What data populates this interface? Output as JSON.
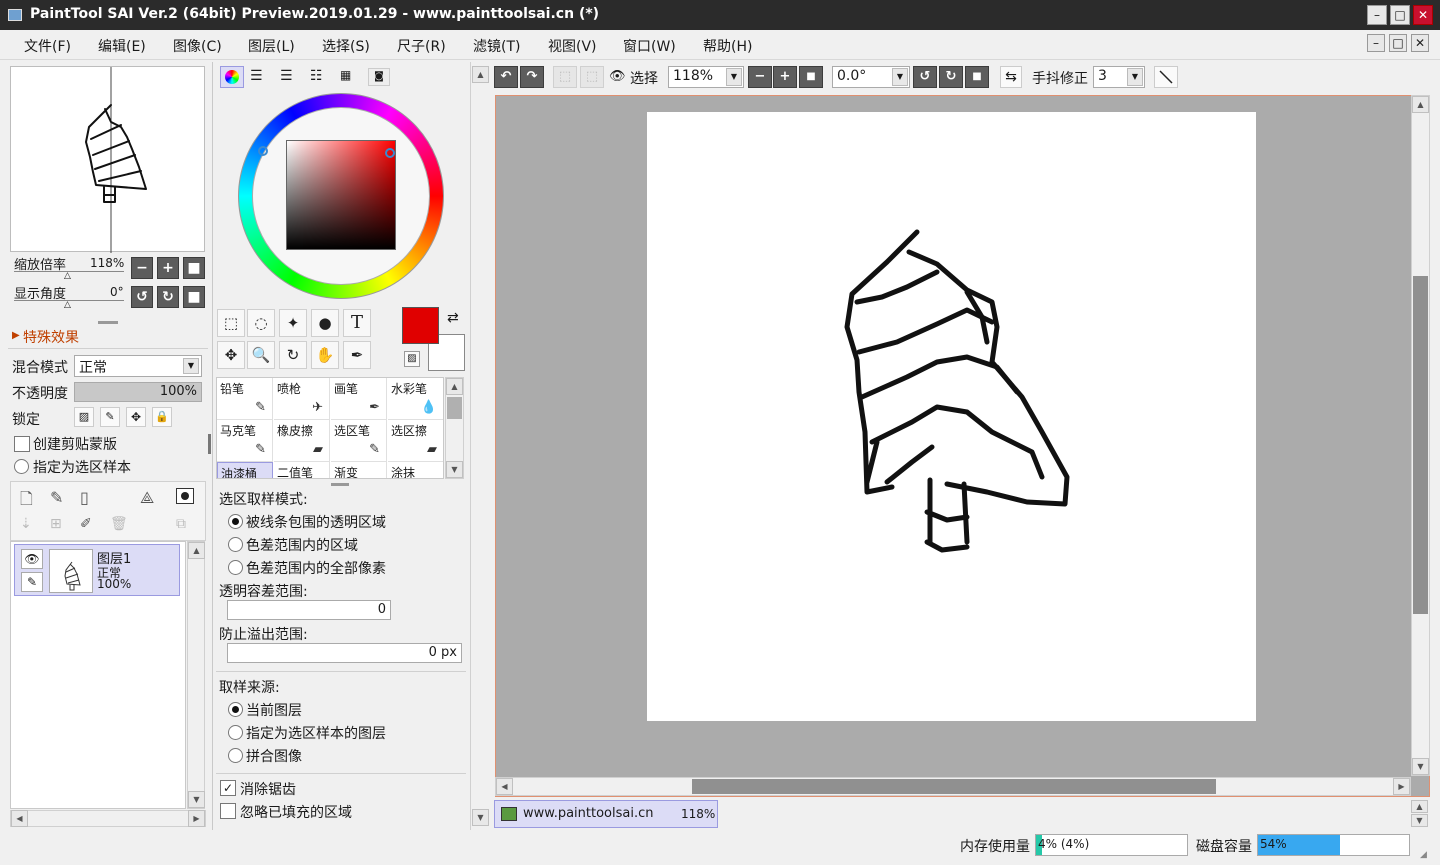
{
  "window": {
    "title": "PaintTool SAI Ver.2 (64bit) Preview.2019.01.29 - www.painttoolsai.cn (*)",
    "minimize": "–",
    "maximize": "□",
    "close": "✕"
  },
  "menu": [
    "文件(F)",
    "编辑(E)",
    "图像(C)",
    "图层(L)",
    "选择(S)",
    "尺子(R)",
    "滤镜(T)",
    "视图(V)",
    "窗口(W)",
    "帮助(H)"
  ],
  "navigator": {
    "zoom_label": "缩放倍率",
    "zoom_value": "118%",
    "angle_label": "显示角度",
    "angle_value": "0°"
  },
  "layer_props": {
    "effects_label": "特殊效果",
    "blend_label": "混合模式",
    "blend_value": "正常",
    "opacity_label": "不透明度",
    "opacity_value": "100%",
    "lock_label": "锁定",
    "clip_label": "创建剪贴蒙版",
    "sample_label": "指定为选区样本"
  },
  "layers": [
    {
      "name": "图层1",
      "mode": "正常",
      "opacity": "100%"
    }
  ],
  "brushes": [
    {
      "label": "铅笔",
      "icon": "✎"
    },
    {
      "label": "喷枪",
      "icon": "✈"
    },
    {
      "label": "画笔",
      "icon": "✒"
    },
    {
      "label": "水彩笔",
      "icon": "💧"
    },
    {
      "label": "马克笔",
      "icon": "✎"
    },
    {
      "label": "橡皮擦",
      "icon": "▰"
    },
    {
      "label": "选区笔",
      "icon": "✎"
    },
    {
      "label": "选区擦",
      "icon": "▰"
    },
    {
      "label": "油漆桶",
      "icon": ""
    },
    {
      "label": "二值笔",
      "icon": ""
    },
    {
      "label": "渐变",
      "icon": ""
    },
    {
      "label": "涂抹",
      "icon": ""
    }
  ],
  "tool_options": {
    "sample_mode_label": "选区取样模式:",
    "sample_modes": [
      "被线条包围的透明区域",
      "色差范围内的区域",
      "色差范围内的全部像素"
    ],
    "tolerance_label": "透明容差范围:",
    "tolerance_value": "0",
    "overflow_label": "防止溢出范围:",
    "overflow_value": "0 px",
    "source_label": "取样来源:",
    "sources": [
      "当前图层",
      "指定为选区样本的图层",
      "拼合图像"
    ],
    "antialias_label": "消除锯齿",
    "ignore_filled_label": "忽略已填充的区域"
  },
  "toolbar": {
    "select_label": "选择",
    "zoom_value": "118%",
    "angle_value": "0.0°",
    "stabilizer_label": "手抖修正",
    "stabilizer_value": "3"
  },
  "colors": {
    "primary": "#e00000",
    "secondary": "#ffffff"
  },
  "document_tab": {
    "name": "www.painttoolsai.cn",
    "zoom": "118%"
  },
  "status": {
    "memory_label": "内存使用量",
    "memory_value": "4% (4%)",
    "memory_fraction": 0.04,
    "disk_label": "磁盘容量",
    "disk_value": "54%",
    "disk_fraction": 0.54
  }
}
